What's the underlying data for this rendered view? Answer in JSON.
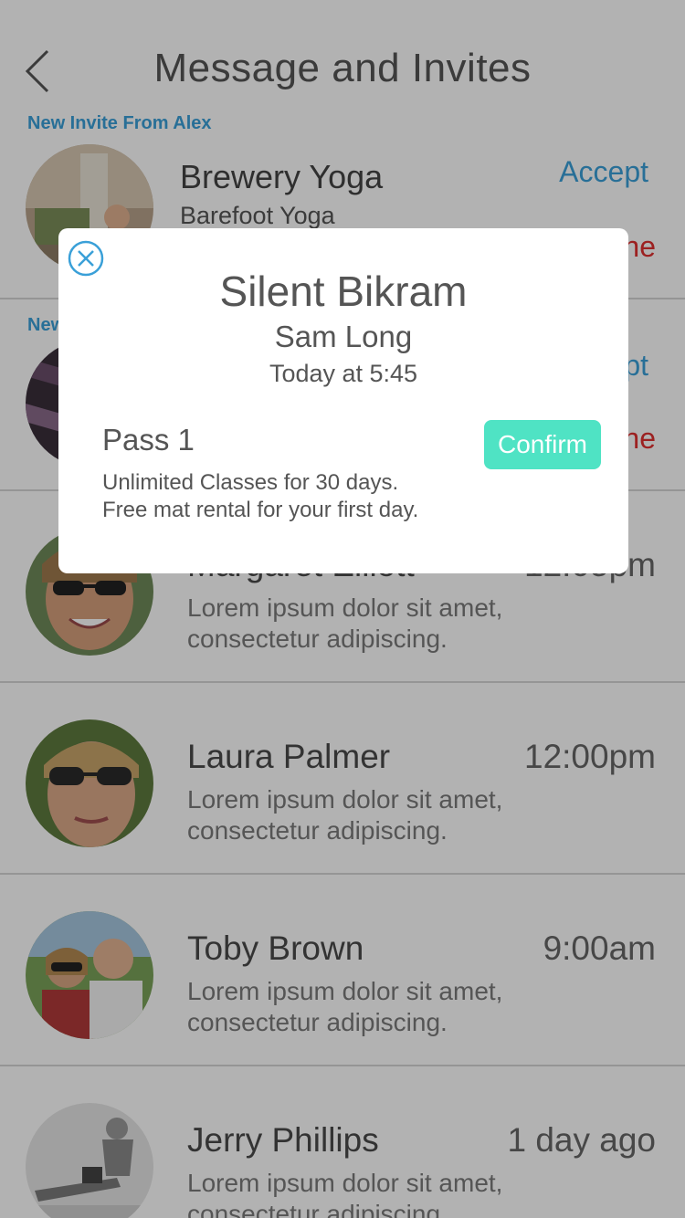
{
  "header": {
    "title": "Message and Invites"
  },
  "invites": [
    {
      "label": "New Invite From Alex",
      "title": "Brewery Yoga",
      "subtitle": "Barefoot Yoga",
      "accept": "Accept",
      "decline": "Decline"
    },
    {
      "label": "New Invite From",
      "title": "",
      "subtitle": "",
      "accept": "Accept",
      "decline": "Decline"
    }
  ],
  "messages": [
    {
      "name": "Margaret Elliott",
      "time": "12:05pm",
      "preview": "Lorem ipsum dolor sit amet, consectetur adipiscing."
    },
    {
      "name": "Laura Palmer",
      "time": "12:00pm",
      "preview": "Lorem ipsum dolor sit amet, consectetur adipiscing."
    },
    {
      "name": "Toby Brown",
      "time": "9:00am",
      "preview": "Lorem ipsum dolor sit amet, consectetur adipiscing."
    },
    {
      "name": "Jerry Phillips",
      "time": "1 day ago",
      "preview": "Lorem ipsum dolor sit amet, consectetur adipiscing."
    }
  ],
  "modal": {
    "title": "Silent Bikram",
    "instructor": "Sam Long",
    "time": "Today at 5:45",
    "pass": {
      "name": "Pass 1",
      "desc_line1": "Unlimited Classes for 30 days.",
      "desc_line2": "Free mat rental for your first day.",
      "confirm": "Confirm"
    }
  },
  "colors": {
    "accent": "#3aa0d8",
    "decline": "#e03030",
    "confirm": "#4fe3c4",
    "overlay": "rgba(0,0,0,0.3)"
  },
  "icons": {
    "back": "chevron-left-icon",
    "close": "close-circle-icon"
  }
}
